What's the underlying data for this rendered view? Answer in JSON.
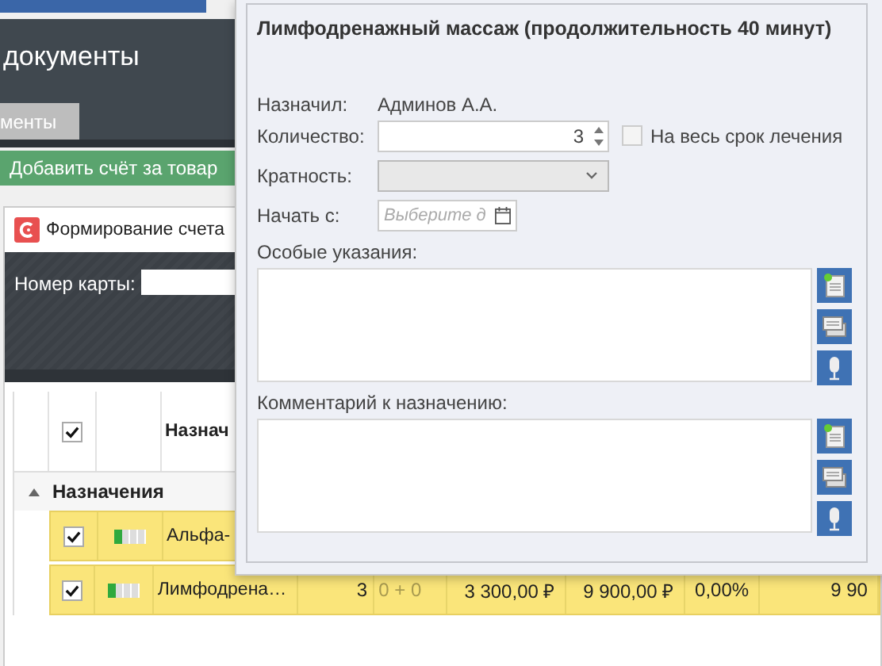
{
  "page": {
    "title": "документы",
    "tab": {
      "label": "менты",
      "selected": true
    },
    "add_button": "Добавить счёт за товар"
  },
  "invoice_window": {
    "title": "Формирование счета",
    "card_label": "Номер карты:"
  },
  "table": {
    "header_checked": true,
    "columns": [
      "Назнач"
    ],
    "group": {
      "label": "Назначения",
      "expanded": true
    },
    "rows": [
      {
        "checked": true,
        "level": 0.25,
        "cells": [
          "Альфа-"
        ]
      },
      {
        "checked": true,
        "level": 0.25,
        "cells": [
          "Лимфодрена…",
          "3",
          "0 + 0",
          "3 300,00 ₽",
          "9 900,00 ₽",
          "0,00%",
          "9 90"
        ]
      }
    ]
  },
  "popup": {
    "title": "Лимфодренажный массаж (продолжительность 40 минут)",
    "prescribed_by": {
      "label": "Назначил:",
      "value": "Админов А.А."
    },
    "quantity": {
      "label": "Количество:",
      "value": "3"
    },
    "whole_course": {
      "label": "На весь срок лечения",
      "checked": false
    },
    "frequency": {
      "label": "Кратность:"
    },
    "start": {
      "label": "Начать с:",
      "placeholder": "Выберите д"
    },
    "special_instructions": {
      "label": "Особые указания:"
    },
    "comment": {
      "label": "Комментарий к назначению:"
    }
  }
}
